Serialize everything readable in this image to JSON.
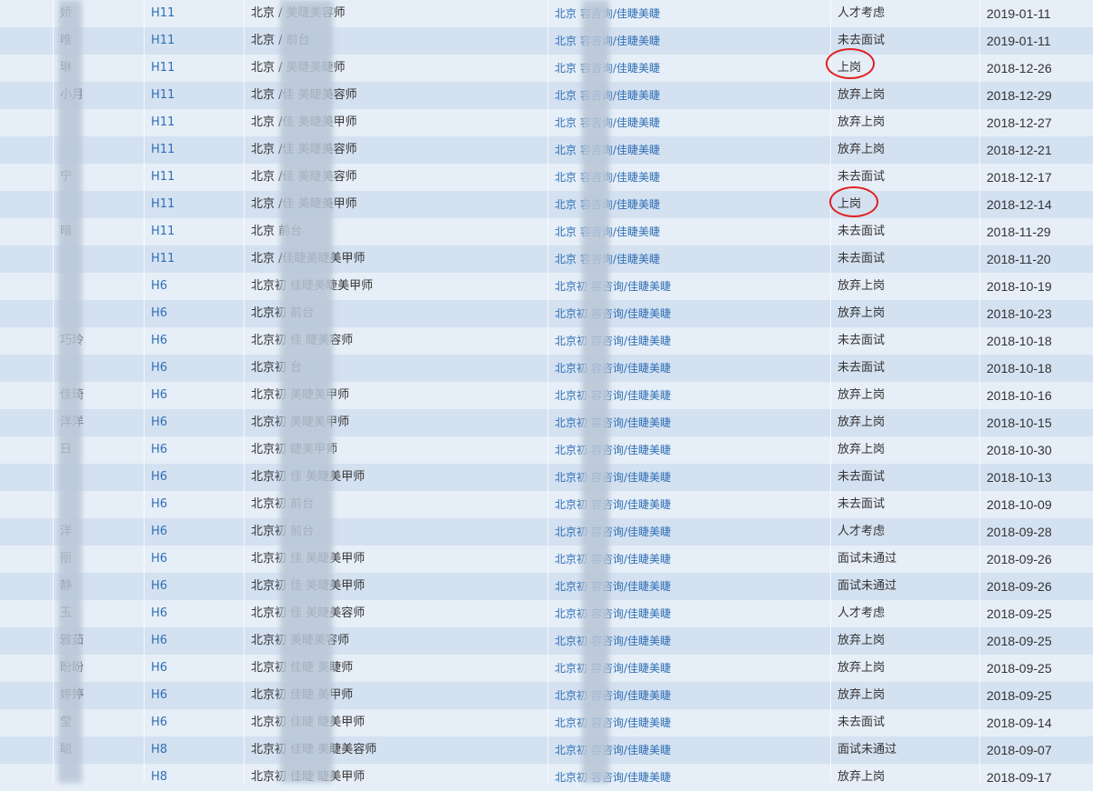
{
  "table": {
    "rows": [
      {
        "name": "娇",
        "code": "H11",
        "position": "北京 /  美睫美容师",
        "company": "北京  容咨询/佳睫美睫",
        "status": "人才考虑",
        "date": "2019-01-11"
      },
      {
        "name": "唯",
        "code": "H11",
        "position": "北京 /  前台",
        "company": "北京  容咨询/佳睫美睫",
        "status": "未去面试",
        "date": "2019-01-11"
      },
      {
        "name": "琳",
        "code": "H11",
        "position": "北京 /  美睫美睫师",
        "company": "北京  容咨询/佳睫美睫",
        "status": "上岗",
        "date": "2018-12-26"
      },
      {
        "name": "小月",
        "code": "H11",
        "position": "北京 /佳  美睫美容师",
        "company": "北京  容咨询/佳睫美睫",
        "status": "放弃上岗",
        "date": "2018-12-29"
      },
      {
        "name": "",
        "code": "H11",
        "position": "北京 /佳  美睫美甲师",
        "company": "北京  容咨询/佳睫美睫",
        "status": "放弃上岗",
        "date": "2018-12-27"
      },
      {
        "name": "",
        "code": "H11",
        "position": "北京 /佳  美睫美容师",
        "company": "北京  容咨询/佳睫美睫",
        "status": "放弃上岗",
        "date": "2018-12-21"
      },
      {
        "name": "宁",
        "code": "H11",
        "position": "北京 /佳  美睫美容师",
        "company": "北京  容咨询/佳睫美睫",
        "status": "未去面试",
        "date": "2018-12-17"
      },
      {
        "name": "",
        "code": "H11",
        "position": "北京 /佳  美睫美甲师",
        "company": "北京  容咨询/佳睫美睫",
        "status": "上岗",
        "date": "2018-12-14"
      },
      {
        "name": "暗",
        "code": "H11",
        "position": "北京  前台",
        "company": "北京  容咨询/佳睫美睫",
        "status": "未去面试",
        "date": "2018-11-29"
      },
      {
        "name": "",
        "code": "H11",
        "position": "北京 /佳睫美睫美甲师",
        "company": "北京  容咨询/佳睫美睫",
        "status": "未去面试",
        "date": "2018-11-20"
      },
      {
        "name": "",
        "code": "H6",
        "position": "北京初 佳睫美睫美甲师",
        "company": "北京初  容咨询/佳睫美睫",
        "status": "放弃上岗",
        "date": "2018-10-19"
      },
      {
        "name": "",
        "code": "H6",
        "position": "北京初  前台",
        "company": "北京初  容咨询/佳睫美睫",
        "status": "放弃上岗",
        "date": "2018-10-23"
      },
      {
        "name": "巧玲",
        "code": "H6",
        "position": "北京初 佳  睫美容师",
        "company": "北京初  容咨询/佳睫美睫",
        "status": "未去面试",
        "date": "2018-10-18"
      },
      {
        "name": "",
        "code": "H6",
        "position": "北京初  台",
        "company": "北京初  容咨询/佳睫美睫",
        "status": "未去面试",
        "date": "2018-10-18"
      },
      {
        "name": "佳琦",
        "code": "H6",
        "position": "北京初  美睫美甲师",
        "company": "北京初  容咨询/佳睫美睫",
        "status": "放弃上岗",
        "date": "2018-10-16"
      },
      {
        "name": "洋洋",
        "code": "H6",
        "position": "北京初  美睫美甲师",
        "company": "北京初  容咨询/佳睫美睫",
        "status": "放弃上岗",
        "date": "2018-10-15"
      },
      {
        "name": "日",
        "code": "H6",
        "position": "北京初  睫美甲师",
        "company": "北京初  容咨询/佳睫美睫",
        "status": "放弃上岗",
        "date": "2018-10-30"
      },
      {
        "name": "",
        "code": "H6",
        "position": "北京初 佳  美睫美甲师",
        "company": "北京初  容咨询/佳睫美睫",
        "status": "未去面试",
        "date": "2018-10-13"
      },
      {
        "name": "",
        "code": "H6",
        "position": "北京初  前台",
        "company": "北京初  容咨询/佳睫美睫",
        "status": "未去面试",
        "date": "2018-10-09"
      },
      {
        "name": "洋",
        "code": "H6",
        "position": "北京初  前台",
        "company": "北京初  容咨询/佳睫美睫",
        "status": "人才考虑",
        "date": "2018-09-28"
      },
      {
        "name": "丽",
        "code": "H6",
        "position": "北京初 佳  美睫美甲师",
        "company": "北京初  容咨询/佳睫美睫",
        "status": "面试未通过",
        "date": "2018-09-26"
      },
      {
        "name": "静",
        "code": "H6",
        "position": "北京初 佳  美睫美甲师",
        "company": "北京初  容咨询/佳睫美睫",
        "status": "面试未通过",
        "date": "2018-09-26"
      },
      {
        "name": "玉",
        "code": "H6",
        "position": "北京初 佳  美睫美容师",
        "company": "北京初  容咨询/佳睫美睫",
        "status": "人才考虑",
        "date": "2018-09-25"
      },
      {
        "name": "雅茹",
        "code": "H6",
        "position": "北京初  美睫美容师",
        "company": "北京初  容咨询/佳睫美睫",
        "status": "放弃上岗",
        "date": "2018-09-25"
      },
      {
        "name": "盼盼",
        "code": "H6",
        "position": "北京初 佳睫  美睫师",
        "company": "北京初  容咨询/佳睫美睫",
        "status": "放弃上岗",
        "date": "2018-09-25"
      },
      {
        "name": "婷婷",
        "code": "H6",
        "position": "北京初 佳睫  美甲师",
        "company": "北京初  容咨询/佳睫美睫",
        "status": "放弃上岗",
        "date": "2018-09-25"
      },
      {
        "name": "莹",
        "code": "H6",
        "position": "北京初 佳睫  睫美甲师",
        "company": "北京初  容咨询/佳睫美睫",
        "status": "未去面试",
        "date": "2018-09-14"
      },
      {
        "name": "聪",
        "code": "H8",
        "position": "北京初 佳睫  美睫美容师",
        "company": "北京初  容咨询/佳睫美睫",
        "status": "面试未通过",
        "date": "2018-09-07"
      },
      {
        "name": "",
        "code": "H8",
        "position": "北京初 佳睫  睫美甲师",
        "company": "北京初  容咨询/佳睫美睫",
        "status": "放弃上岗",
        "date": "2018-09-17"
      }
    ],
    "highlighted_status": "上岗"
  },
  "colors": {
    "row_odd": "#e6eef7",
    "row_even": "#d4e1f1",
    "link": "#2f6fb5",
    "highlight_circle": "#e02020"
  }
}
